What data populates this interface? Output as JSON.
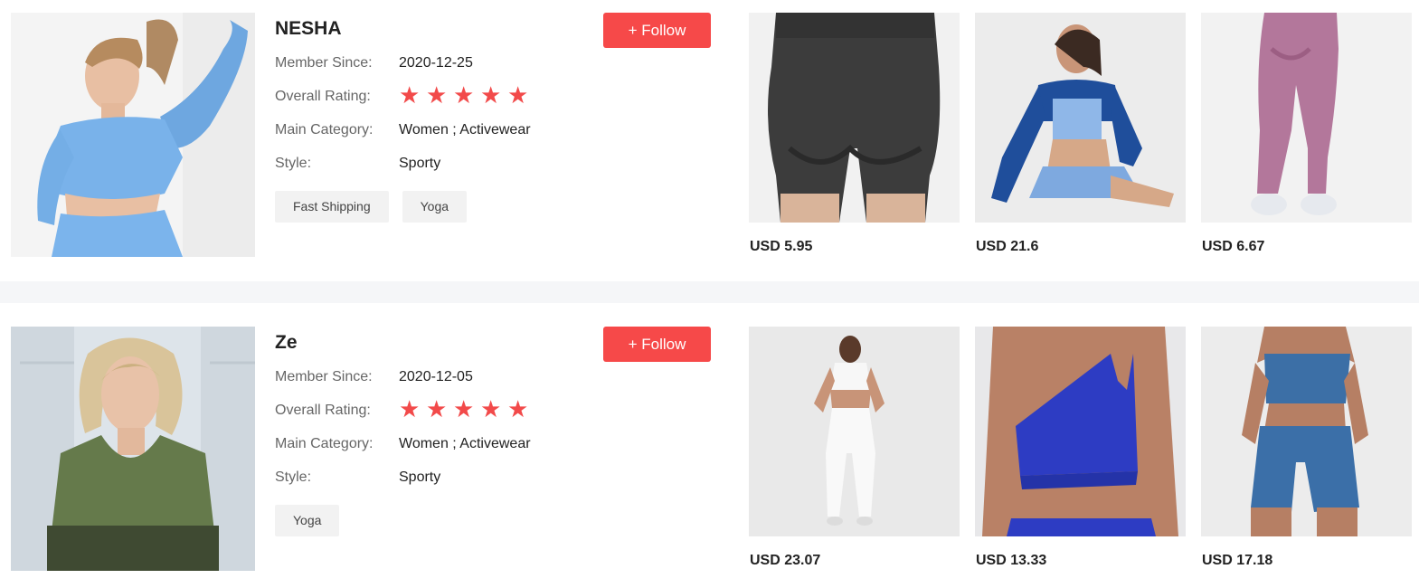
{
  "stores": [
    {
      "name": "NESHA",
      "member_since_label": "Member Since:",
      "member_since": "2020-12-25",
      "rating_label": "Overall Rating:",
      "rating_stars": 5,
      "category_label": "Main Category:",
      "category": "Women ;  Activewear",
      "style_label": "Style:",
      "style": "Sporty",
      "tags": [
        "Fast Shipping",
        "Yoga"
      ],
      "follow_label": "+ Follow",
      "products": [
        {
          "price": "USD 5.95"
        },
        {
          "price": "USD 21.6"
        },
        {
          "price": "USD 6.67"
        }
      ]
    },
    {
      "name": "Ze",
      "member_since_label": "Member Since:",
      "member_since": "2020-12-05",
      "rating_label": "Overall Rating:",
      "rating_stars": 5,
      "category_label": "Main Category:",
      "category": "Women ;  Activewear",
      "style_label": "Style:",
      "style": "Sporty",
      "tags": [
        "Yoga"
      ],
      "follow_label": "+ Follow",
      "products": [
        {
          "price": "USD 23.07"
        },
        {
          "price": "USD 13.33"
        },
        {
          "price": "USD 17.18"
        }
      ]
    }
  ],
  "icons": {
    "star": "star-icon",
    "star_glyph": "★",
    "follow_plus": "plus"
  },
  "colors": {
    "accent": "#f64949",
    "star": "#f24a4a",
    "tag_bg": "#f2f2f2",
    "divider": "#f5f6f8"
  }
}
